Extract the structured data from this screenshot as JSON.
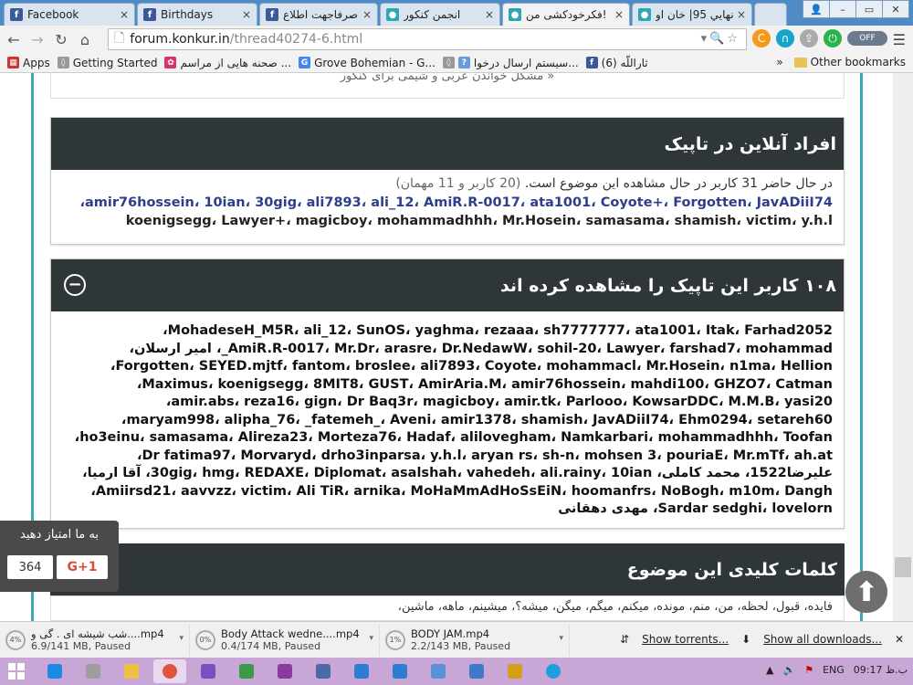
{
  "browser": {
    "tabs": [
      {
        "title": "Facebook",
        "icon": "facebook-icon",
        "color": "#3b5998",
        "active": false
      },
      {
        "title": "Birthdays",
        "icon": "facebook-icon",
        "color": "#3b5998",
        "active": false
      },
      {
        "title": "صرفاجهت اطلاع -",
        "icon": "facebook-icon",
        "color": "#3b5998",
        "active": false
      },
      {
        "title": "انجمن کنکور",
        "icon": "konkur-icon",
        "color": "#2aa7b3",
        "active": false
      },
      {
        "title": "فکرخودکشی من!",
        "icon": "konkur-icon",
        "color": "#2aa7b3",
        "active": true
      },
      {
        "title": "إنهايي 95| خان او",
        "icon": "konkur-icon",
        "color": "#2aa7b3",
        "active": false
      }
    ],
    "url_domain": "forum.konkur.in",
    "url_path": "/thread40274-6.html",
    "toggle_label": "OFF",
    "bookmarks": [
      {
        "label": "Apps",
        "icon": "apps-icon",
        "color": "#c33"
      },
      {
        "label": "Getting Started",
        "icon": "bookmark-icon",
        "color": "#999"
      },
      {
        "label": "صحنه هایی از مراسم ...",
        "icon": "gallery-icon",
        "color": "#d6336c"
      },
      {
        "label": "Grove Bohemian - G...",
        "icon": "google-icon",
        "color": "#4285f4"
      },
      {
        "label": "سیستم ارسال درخوا...",
        "icon": "help-icon",
        "color": "#6a9bd8"
      },
      {
        "label": "(6) ثاراللّه",
        "icon": "facebook-icon",
        "color": "#3b5998"
      }
    ],
    "bookmarks_more": "»",
    "other_bookmarks": "Other bookmarks"
  },
  "page": {
    "prev_thread_link": "« مشکل خواندن عربی و شیمی برای کنکور",
    "online": {
      "title": "افراد آنلاین در تاپیک",
      "summary": "در حال حاضر 31 کاربر در حال مشاهده این موضوع است.",
      "summary_paren": "(20 کاربر و 11 مهمان)",
      "line1": "amir76hossein، 10ian، 30gig، ali7893، ali_12، AmiR.R-0017، ata1001، Coyote+، Forgotten، JavADiiI74،",
      "line2": "koenigsegg، Lawyer+، magicboy، mohammadhhh، Mr.Hosein، samasama، shamish، victim، y.h.l"
    },
    "viewers": {
      "title": "۱۰۸ کاربر این تاپیک را مشاهده کرده اند",
      "lines": [
        "MohadeseH_M5R، ali_12، SunOS، yaghma، rezaaa، sh7777777، ata1001، Itak، Farhad2052،",
        "AmiR.R-0017، Mr.Dr، arasre، Dr.NedawW، sohil-20، Lawyer، farshad7، mohammad_، امیر ارسلان،",
        "Forgotten، SEYED.mjtf، fantom، broslee، ali7893، Coyote، mohammacl، Mr.Hosein، n1ma، Hellion،",
        "Maximus، koenigsegg، 8MIT8، GUST، AmirAria.M، amir76hossein، mahdi100، GHZO7، Catman،",
        "amir.abs، reza16، gign، Dr Baq3r، magicboy، amir.tk، Parlooo، KowsarDDC، M.M.B، yasi20،",
        "maryam998، alipha_76، _fatemeh_، Aveni، amir1378، shamish، JavADiiI74، Ehm0294، setareh60،",
        "ho3einu، samasama، Alireza23، Morteza76، Hadaf، alilovegham، Namkarbari، mohammadhhh، Toofan،",
        "Dr fatima97، Morvaryd، drho3inparsa، y.h.l، aryan rs، sh-n، mohsen 3، pouriaE، Mr.mTf، ah.at،",
        "علیرضا1522، محمد کاملی، 30gig، hmg، REDAXE، Diplomat، asalshah، vahedeh، ali.rainy، 10ian، آقا ارمیا،",
        "Amiirsd21، aavvzz، victim، Ali TiR، arnika، MoHaMmAdHoSsEiN، hoomanfrs، NoBogh، m10m، Dangh،",
        "Sardar sedghi، lovelorn، مهدی دهقانی"
      ]
    },
    "keywords": {
      "title": "کلمات کلیدی این موضوع",
      "text": "فایده، قبول، لحظه، من، منم، مونده، میکنم، میگم، میگن، میشه؟، میشینم، ماهه، ماشین،"
    },
    "share": {
      "label": "به ما امتیاز دهید",
      "count": "364",
      "gplus": "G+1"
    }
  },
  "downloads": {
    "items": [
      {
        "name": "شب شیشه ای . گی و....mp4",
        "status": "6.9/141 MB, Paused",
        "percent": "4%"
      },
      {
        "name": "Body Attack wedne....mp4",
        "status": "0.4/174 MB, Paused",
        "percent": "0%"
      },
      {
        "name": "BODY JAM.mp4",
        "status": "2.2/143 MB, Paused",
        "percent": "1%"
      }
    ],
    "show_torrents": "Show torrents...",
    "show_all": "Show all downloads..."
  },
  "taskbar": {
    "lang": "ENG",
    "time": "09:17 ب.ظ"
  },
  "colors": {
    "accent_teal": "#3aa9b5",
    "header_dark": "#2f3638",
    "taskbar": "#c8a6d6"
  }
}
